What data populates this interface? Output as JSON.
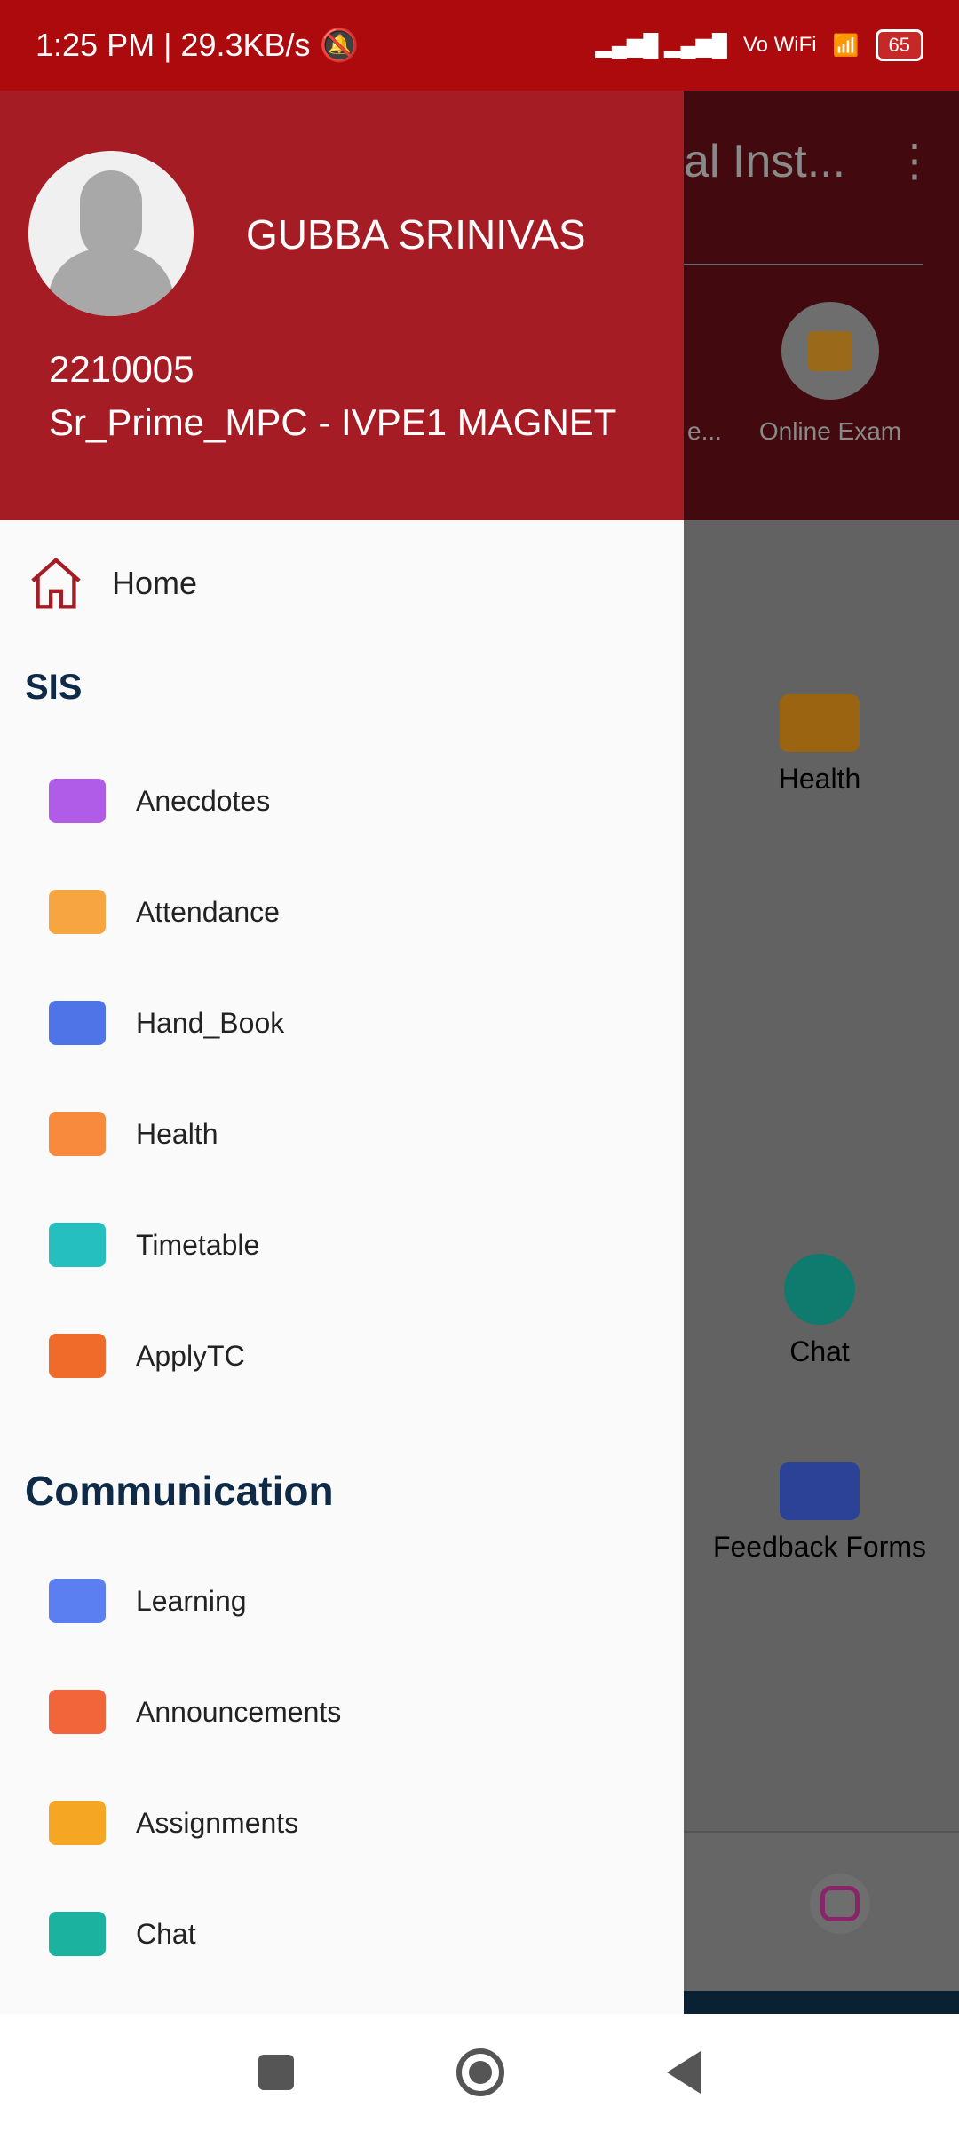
{
  "status_bar": {
    "time": "1:25 PM | 29.3KB/s",
    "network": "Vo WiFi",
    "battery": "65"
  },
  "background": {
    "title": "al Inst...",
    "online_exam": "Online Exam",
    "truncated": "e...",
    "tiles": [
      "Health",
      "Chat",
      "Feedback Forms"
    ]
  },
  "drawer": {
    "user_name": "GUBBA SRINIVAS",
    "student_id": "2210005",
    "class": "Sr_Prime_MPC - IVPE1 MAGNET",
    "home": "Home",
    "sections": [
      {
        "title": "SIS",
        "items": [
          {
            "label": "Anecdotes",
            "color": "#b05ce8"
          },
          {
            "label": "Attendance",
            "color": "#f7a541"
          },
          {
            "label": "Hand_Book",
            "color": "#4f74e8"
          },
          {
            "label": "Health",
            "color": "#f78a3c"
          },
          {
            "label": "Timetable",
            "color": "#26bfbf"
          },
          {
            "label": "ApplyTC",
            "color": "#f06a2a"
          }
        ]
      },
      {
        "title": "Communication",
        "items": [
          {
            "label": "Learning",
            "color": "#5b7ef0"
          },
          {
            "label": "Announcements",
            "color": "#f2643a"
          },
          {
            "label": "Assignments",
            "color": "#f5a623"
          },
          {
            "label": "Chat",
            "color": "#1bb3a0"
          }
        ]
      }
    ]
  },
  "colors": {
    "primary": "#a61c24",
    "status": "#ad0a0e",
    "heading": "#0e2a47"
  }
}
